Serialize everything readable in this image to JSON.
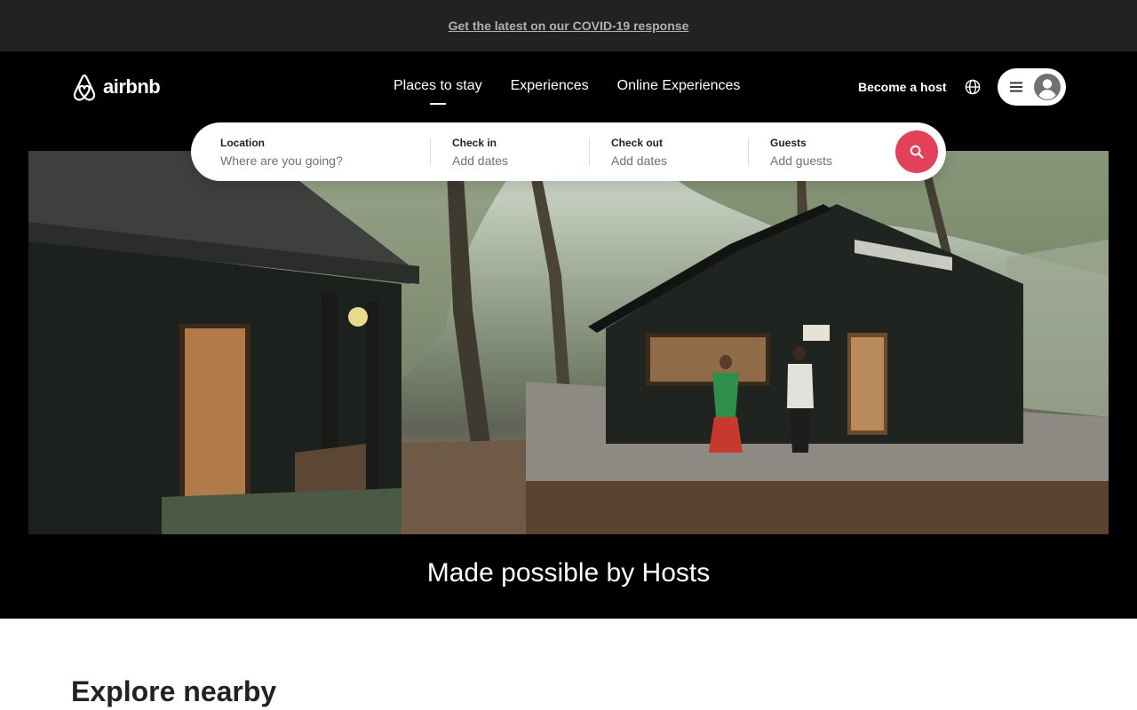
{
  "banner": {
    "link_text": "Get the latest on our COVID-19 response"
  },
  "header": {
    "logo_text": "airbnb",
    "tabs": [
      {
        "label": "Places to stay",
        "active": true
      },
      {
        "label": "Experiences",
        "active": false
      },
      {
        "label": "Online Experiences",
        "active": false
      }
    ],
    "become_host": "Become a host",
    "icons": {
      "language": "globe-icon",
      "menu": "hamburger-menu-icon",
      "profile": "user-avatar-icon"
    }
  },
  "search": {
    "location": {
      "label": "Location",
      "placeholder": "Where are you going?"
    },
    "check_in": {
      "label": "Check in",
      "placeholder": "Add dates"
    },
    "check_out": {
      "label": "Check out",
      "placeholder": "Add dates"
    },
    "guests": {
      "label": "Guests",
      "placeholder": "Add guests"
    },
    "button_icon": "search-icon"
  },
  "hero": {
    "caption": "Made possible by Hosts"
  },
  "explore": {
    "title": "Explore nearby"
  },
  "colors": {
    "brand": "#E3415A",
    "banner_bg": "#222222",
    "hero_bg": "#000000"
  }
}
